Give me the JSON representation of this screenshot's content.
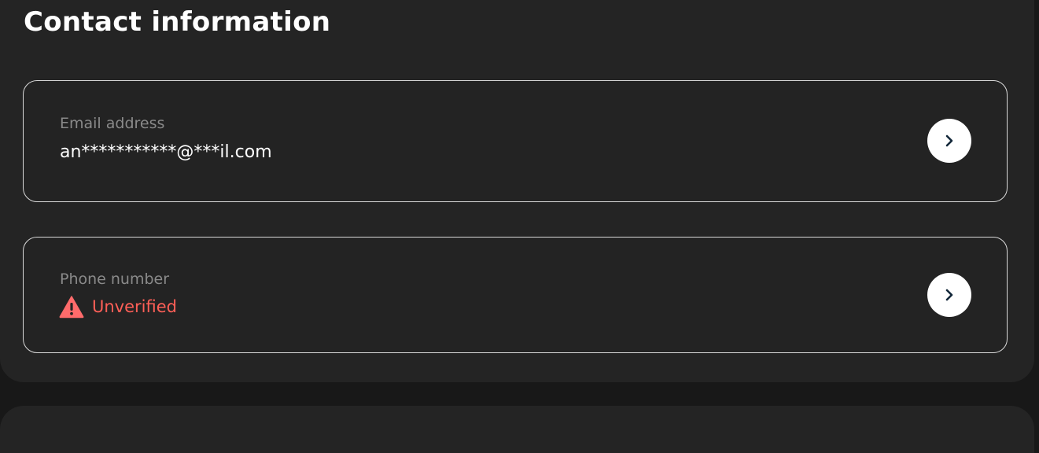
{
  "section": {
    "title": "Contact information"
  },
  "email": {
    "label": "Email address",
    "value": "an***********@***il.com",
    "action_icon": "chevron-right-icon"
  },
  "phone": {
    "label": "Phone number",
    "status": "Unverified",
    "status_icon": "warning-icon",
    "status_color": "#ff5f57",
    "action_icon": "chevron-right-icon"
  }
}
